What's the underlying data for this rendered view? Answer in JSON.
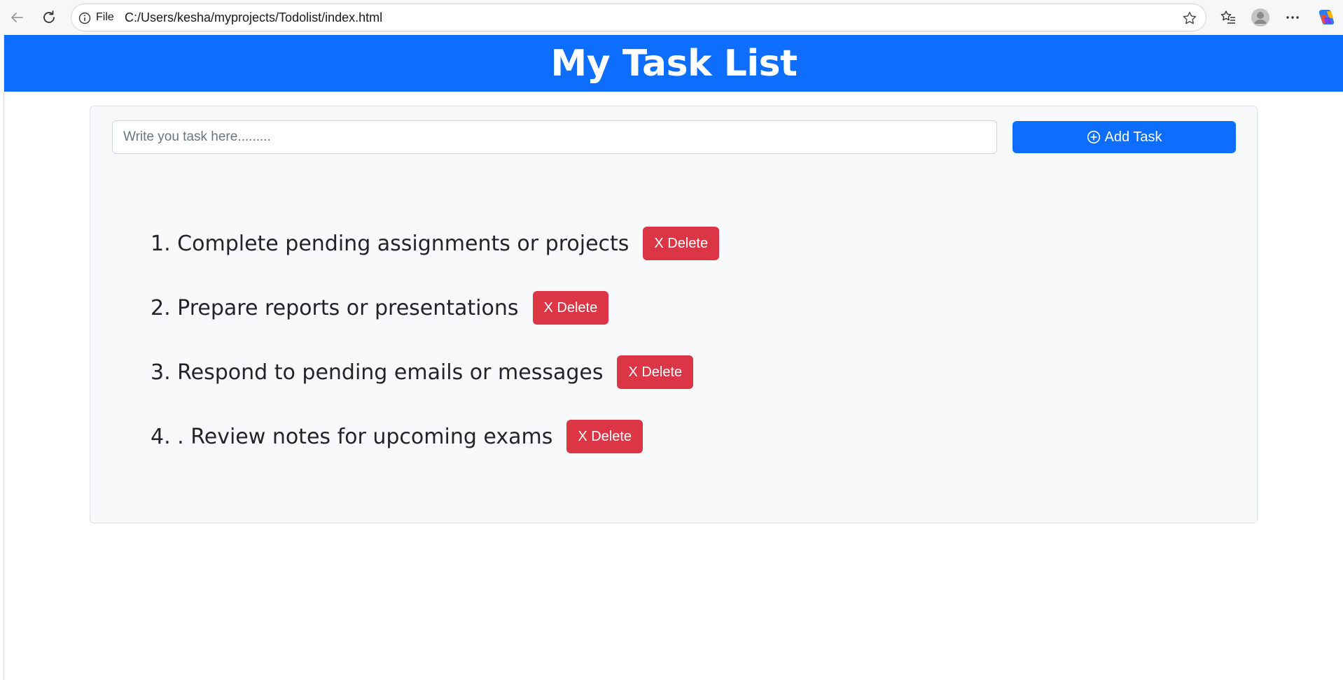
{
  "browser": {
    "file_label": "File",
    "url": "C:/Users/kesha/myprojects/Todolist/index.html"
  },
  "header": {
    "title": "My Task List"
  },
  "form": {
    "placeholder": "Write you task here.........",
    "add_label": "Add Task"
  },
  "tasks": [
    {
      "number": "1.",
      "text": "Complete pending assignments or projects",
      "delete_label": "X Delete"
    },
    {
      "number": "2.",
      "text": "Prepare reports or presentations",
      "delete_label": "X Delete"
    },
    {
      "number": "3.",
      "text": "Respond to pending emails or messages",
      "delete_label": "X Delete"
    },
    {
      "number": "4.",
      "text": ". Review notes for upcoming exams",
      "delete_label": "X Delete"
    }
  ],
  "colors": {
    "primary": "#0d6efd",
    "danger": "#dc3545",
    "card_bg": "#f8f9fa"
  }
}
